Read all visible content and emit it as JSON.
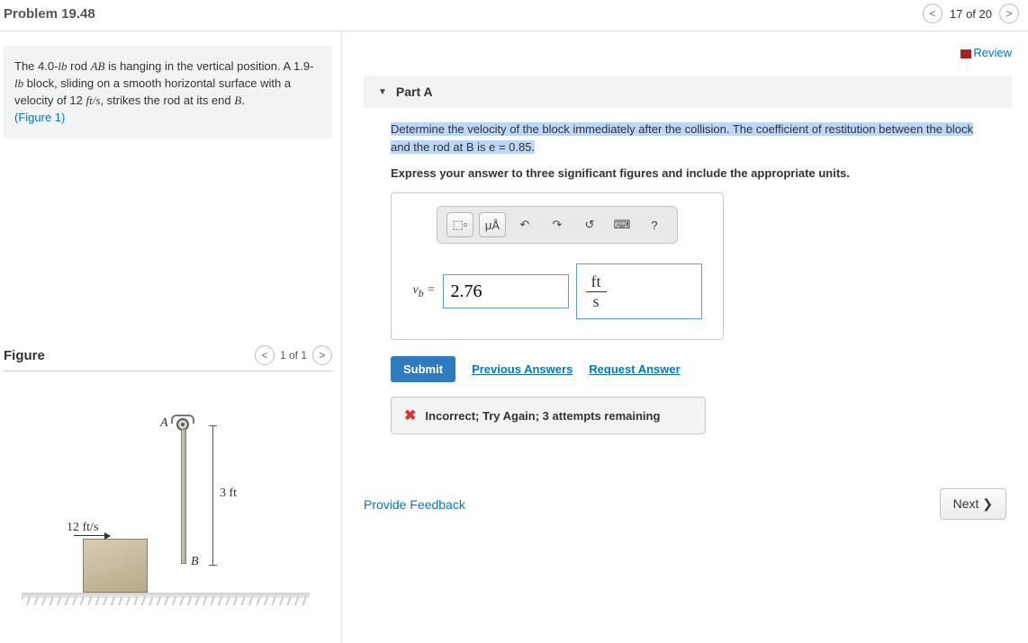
{
  "header": {
    "title": "Problem 19.48",
    "pager_text": "17 of 20"
  },
  "intro": {
    "line1a": "The 4.0-",
    "line1b": "lb",
    "line1c": " rod ",
    "line1d": "AB",
    "line1e": " is hanging in the vertical position. A 1.9-",
    "line1f": "lb",
    "line1g": " block, sliding on a smooth horizontal surface with a velocity of 12 ",
    "line1h": "ft/s",
    "line1i": ", strikes the rod at its end ",
    "line1j": "B",
    "line1k": ".",
    "figlink": "(Figure 1)"
  },
  "figure": {
    "heading": "Figure",
    "pager": "1 of 1",
    "labelA": "A",
    "labelB": "B",
    "dim": "3 ft",
    "velocity": "12 ft/s"
  },
  "review": "Review",
  "part": {
    "label": "Part A",
    "q_hl": "Determine the velocity of the block immediately after the collision. The coefficient of restitution between the block and the rod at B is e = 0.85.",
    "instruct": "Express your answer to three significant figures and include the appropriate units.",
    "toolbar": {
      "templates": "⬚▫",
      "units": "μÅ",
      "undo": "↶",
      "redo": "↷",
      "reset": "↺",
      "keyboard": "⌨",
      "help": "?"
    },
    "var": "v",
    "var_sub": "b",
    "eq": " = ",
    "value": "2.76",
    "unit_num": "ft",
    "unit_den": "s",
    "submit": "Submit",
    "prev_ans": "Previous Answers",
    "req_ans": "Request Answer",
    "feedback": "Incorrect; Try Again; 3 attempts remaining"
  },
  "bottom": {
    "provide": "Provide Feedback",
    "next": "Next ❯"
  }
}
